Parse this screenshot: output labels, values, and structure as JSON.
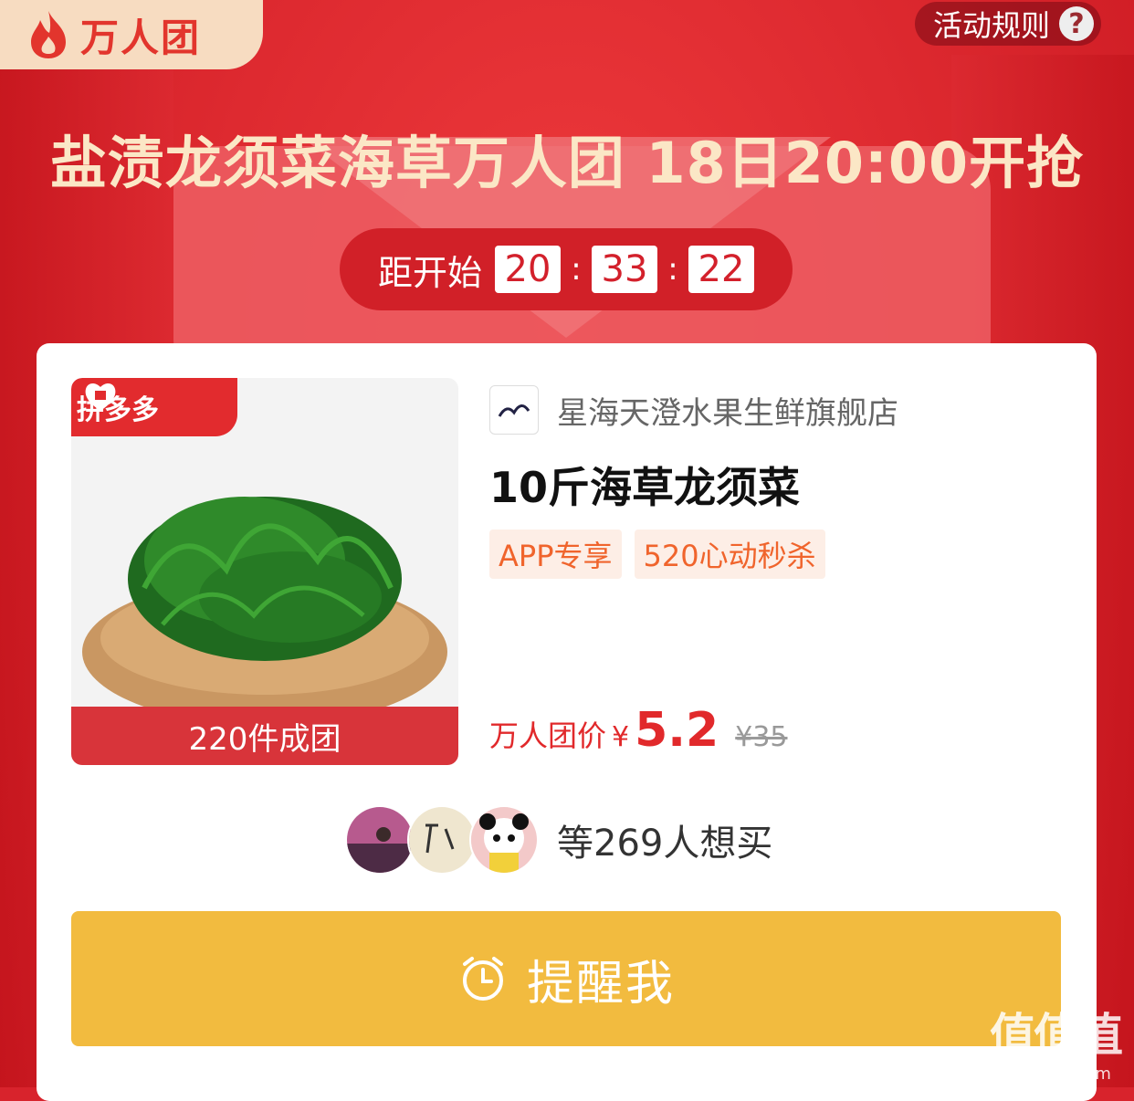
{
  "badge": {
    "label": "万人团"
  },
  "rules": {
    "label": "活动规则",
    "icon": "?"
  },
  "headline": "盐渍龙须菜海草万人团 18日20:00开抢",
  "countdown": {
    "label": "距开始",
    "hours": "20",
    "minutes": "33",
    "seconds": "22",
    "sep": ":"
  },
  "product": {
    "platform": "拼多多",
    "group_size": "220件成团",
    "store_name": "星海天澄水果生鲜旗舰店",
    "title": "10斤海草龙须菜",
    "tags": [
      "APP专享",
      "520心动秒杀"
    ],
    "price_label": "万人团价",
    "currency": "¥",
    "price": "5.2",
    "old_price": "¥35"
  },
  "want": {
    "text": "等269人想买"
  },
  "remind": {
    "label": "提醒我"
  },
  "watermark": {
    "big": "值值值",
    "small": "zhizhizhi.com"
  },
  "colors": {
    "primary": "#d8232c",
    "button": "#f2bb3f",
    "price": "#e1292b"
  }
}
